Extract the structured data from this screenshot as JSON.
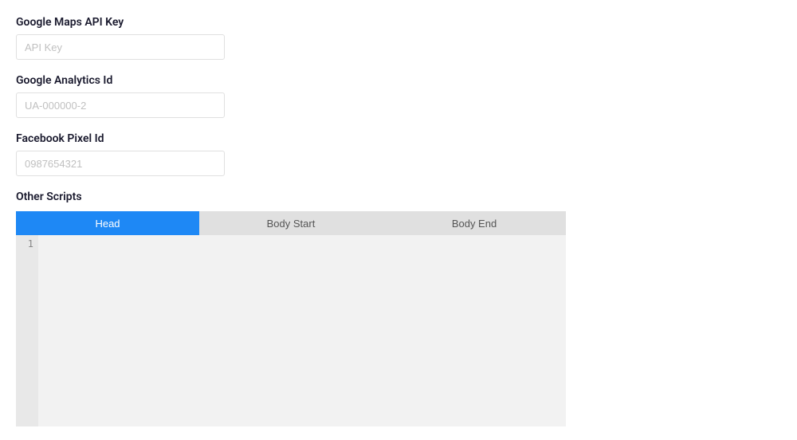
{
  "fields": {
    "google_maps": {
      "label": "Google Maps API Key",
      "placeholder": "API Key",
      "value": ""
    },
    "google_analytics": {
      "label": "Google Analytics Id",
      "placeholder": "UA-000000-2",
      "value": ""
    },
    "facebook_pixel": {
      "label": "Facebook Pixel Id",
      "placeholder": "0987654321",
      "value": ""
    }
  },
  "scripts_section": {
    "label": "Other Scripts",
    "tabs": [
      {
        "label": "Head",
        "active": true
      },
      {
        "label": "Body Start",
        "active": false
      },
      {
        "label": "Body End",
        "active": false
      }
    ],
    "editor": {
      "line_numbers": [
        "1"
      ],
      "content": ""
    }
  }
}
